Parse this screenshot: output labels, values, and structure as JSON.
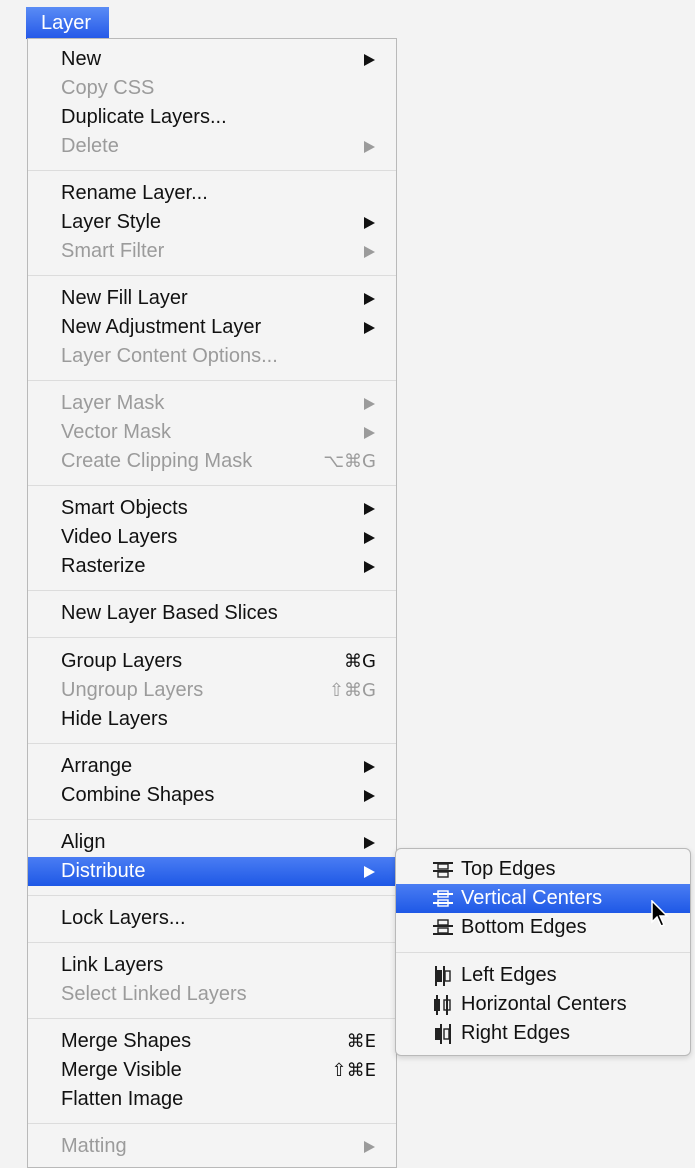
{
  "menu": {
    "title": "Layer",
    "items": [
      {
        "label": "New",
        "arrow": true
      },
      {
        "label": "Copy CSS",
        "disabled": true
      },
      {
        "label": "Duplicate Layers..."
      },
      {
        "label": "Delete",
        "disabled": true,
        "arrow": true
      },
      {
        "label": "Rename Layer..."
      },
      {
        "label": "Layer Style",
        "arrow": true
      },
      {
        "label": "Smart Filter",
        "disabled": true,
        "arrow": true
      },
      {
        "label": "New Fill Layer",
        "arrow": true
      },
      {
        "label": "New Adjustment Layer",
        "arrow": true
      },
      {
        "label": "Layer Content Options...",
        "disabled": true
      },
      {
        "label": "Layer Mask",
        "disabled": true,
        "arrow": true
      },
      {
        "label": "Vector Mask",
        "disabled": true,
        "arrow": true
      },
      {
        "label": "Create Clipping Mask",
        "disabled": true,
        "shortcut": "⌥⌘G"
      },
      {
        "label": "Smart Objects",
        "arrow": true
      },
      {
        "label": "Video Layers",
        "arrow": true
      },
      {
        "label": "Rasterize",
        "arrow": true
      },
      {
        "label": "New Layer Based Slices"
      },
      {
        "label": "Group Layers",
        "shortcut": "⌘G"
      },
      {
        "label": "Ungroup Layers",
        "disabled": true,
        "shortcut": "⇧⌘G"
      },
      {
        "label": "Hide Layers"
      },
      {
        "label": "Arrange",
        "arrow": true
      },
      {
        "label": "Combine Shapes",
        "arrow": true
      },
      {
        "label": "Align",
        "arrow": true
      },
      {
        "label": "Distribute",
        "arrow": true,
        "highlighted": true
      },
      {
        "label": "Lock Layers..."
      },
      {
        "label": "Link Layers"
      },
      {
        "label": "Select Linked Layers",
        "disabled": true
      },
      {
        "label": "Merge Shapes",
        "shortcut": "⌘E"
      },
      {
        "label": "Merge Visible",
        "shortcut": "⇧⌘E"
      },
      {
        "label": "Flatten Image"
      },
      {
        "label": "Matting",
        "disabled": true,
        "arrow": true
      }
    ]
  },
  "submenu": {
    "items": [
      {
        "label": "Top Edges",
        "icon": "distribute-top-edges-icon"
      },
      {
        "label": "Vertical Centers",
        "icon": "distribute-vertical-centers-icon",
        "highlighted": true
      },
      {
        "label": "Bottom Edges",
        "icon": "distribute-bottom-edges-icon"
      },
      {
        "label": "Left Edges",
        "icon": "distribute-left-edges-icon"
      },
      {
        "label": "Horizontal Centers",
        "icon": "distribute-horizontal-centers-icon"
      },
      {
        "label": "Right Edges",
        "icon": "distribute-right-edges-icon"
      }
    ]
  },
  "colors": {
    "highlight": "#2458e8",
    "disabled": "#9b9b9b",
    "text": "#111111"
  }
}
